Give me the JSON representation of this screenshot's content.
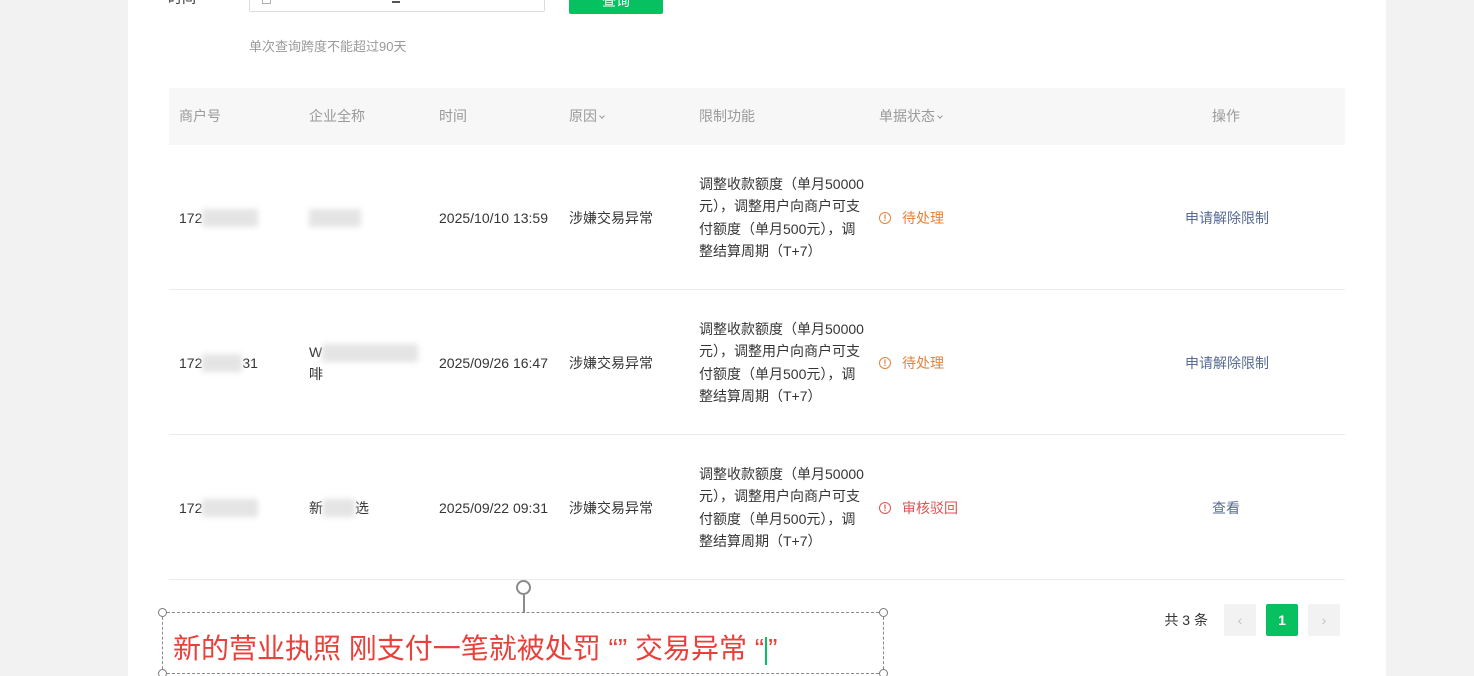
{
  "filter": {
    "label": "时间",
    "query_button": "查询",
    "hint": "单次查询跨度不能超过90天"
  },
  "table": {
    "headers": {
      "merchant_id": "商户号",
      "company": "企业全称",
      "time": "时间",
      "reason": "原因",
      "limits": "限制功能",
      "status": "单据状态",
      "action": "操作"
    },
    "rows": [
      {
        "merchant_id": "172",
        "company": "",
        "time": "2025/10/10 13:59",
        "reason": "涉嫌交易异常",
        "limits": "调整收款额度（单月50000元），调整用户向商户可支付额度（单月500元），调整结算周期（T+7）",
        "status": "待处理",
        "action": "申请解除限制"
      },
      {
        "merchant_id": "172",
        "merchant_id_suffix": "31",
        "company": "W",
        "company_line2": "啡",
        "time": "2025/09/26 16:47",
        "reason": "涉嫌交易异常",
        "limits": "调整收款额度（单月50000元），调整用户向商户可支付额度（单月500元），调整结算周期（T+7）",
        "status": "待处理",
        "action": "申请解除限制"
      },
      {
        "merchant_id": "172",
        "company": "新",
        "company_suffix": "选",
        "time": "2025/09/22 09:31",
        "reason": "涉嫌交易异常",
        "limits": "调整收款额度（单月50000元），调整用户向商户可支付额度（单月500元），调整结算周期（T+7）",
        "status": "审核驳回",
        "action": "查看"
      }
    ]
  },
  "pagination": {
    "total": "共 3 条",
    "current": "1",
    "prev": "‹",
    "next": "›"
  },
  "annotation": {
    "text": "新的营业执照 刚支付一笔就被处罚 “” 交易异常 “",
    "text_end": "”"
  },
  "colors": {
    "brand": "#07c160",
    "pending": "#e3833b",
    "rejected": "#e15252",
    "link": "#576b95",
    "annotation": "#e8403a"
  }
}
